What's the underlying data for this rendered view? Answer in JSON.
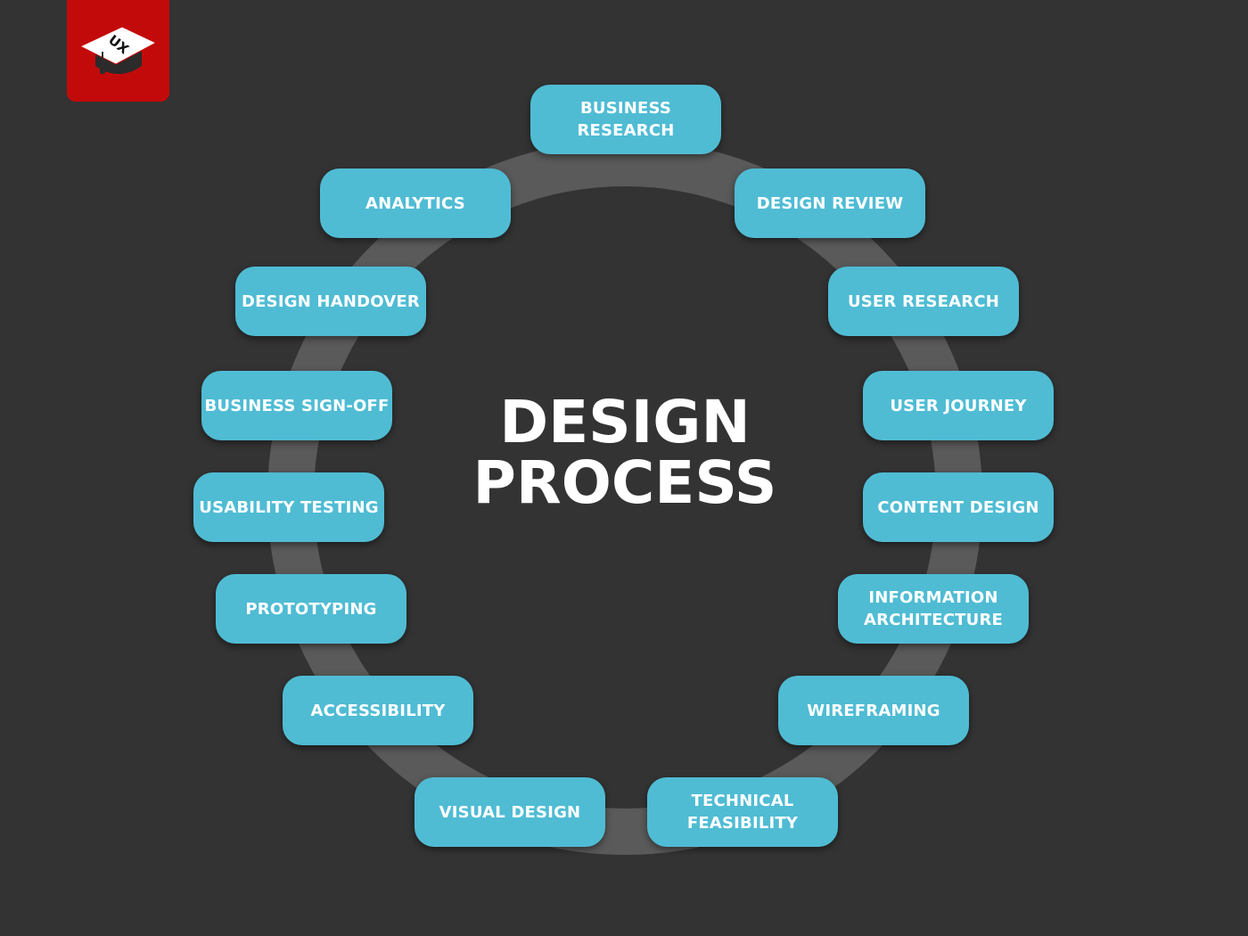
{
  "title": "DESIGN\nPROCESS",
  "logo": {
    "icon": "graduation-cap-icon",
    "text": "UX",
    "background": "#c30a0a"
  },
  "colors": {
    "background": "#333333",
    "ring": "#5a5a5a",
    "node": "#4fbcd4",
    "text": "#ffffff"
  },
  "steps": [
    {
      "id": "business-research",
      "label": "BUSINESS\nRESEARCH"
    },
    {
      "id": "design-review",
      "label": "DESIGN REVIEW"
    },
    {
      "id": "user-research",
      "label": "USER RESEARCH"
    },
    {
      "id": "user-journey",
      "label": "USER JOURNEY"
    },
    {
      "id": "content-design",
      "label": "CONTENT DESIGN"
    },
    {
      "id": "information-architecture",
      "label": "INFORMATION\nARCHITECTURE"
    },
    {
      "id": "wireframing",
      "label": "WIREFRAMING"
    },
    {
      "id": "technical-feasibility",
      "label": "TECHNICAL\nFEASIBILITY"
    },
    {
      "id": "visual-design",
      "label": "VISUAL DESIGN"
    },
    {
      "id": "accessibility",
      "label": "ACCESSIBILITY"
    },
    {
      "id": "prototyping",
      "label": "PROTOTYPING"
    },
    {
      "id": "usability-testing",
      "label": "USABILITY TESTING"
    },
    {
      "id": "business-sign-off",
      "label": "BUSINESS SIGN-OFF"
    },
    {
      "id": "design-handover",
      "label": "DESIGN HANDOVER"
    },
    {
      "id": "analytics",
      "label": "ANALYTICS"
    }
  ]
}
